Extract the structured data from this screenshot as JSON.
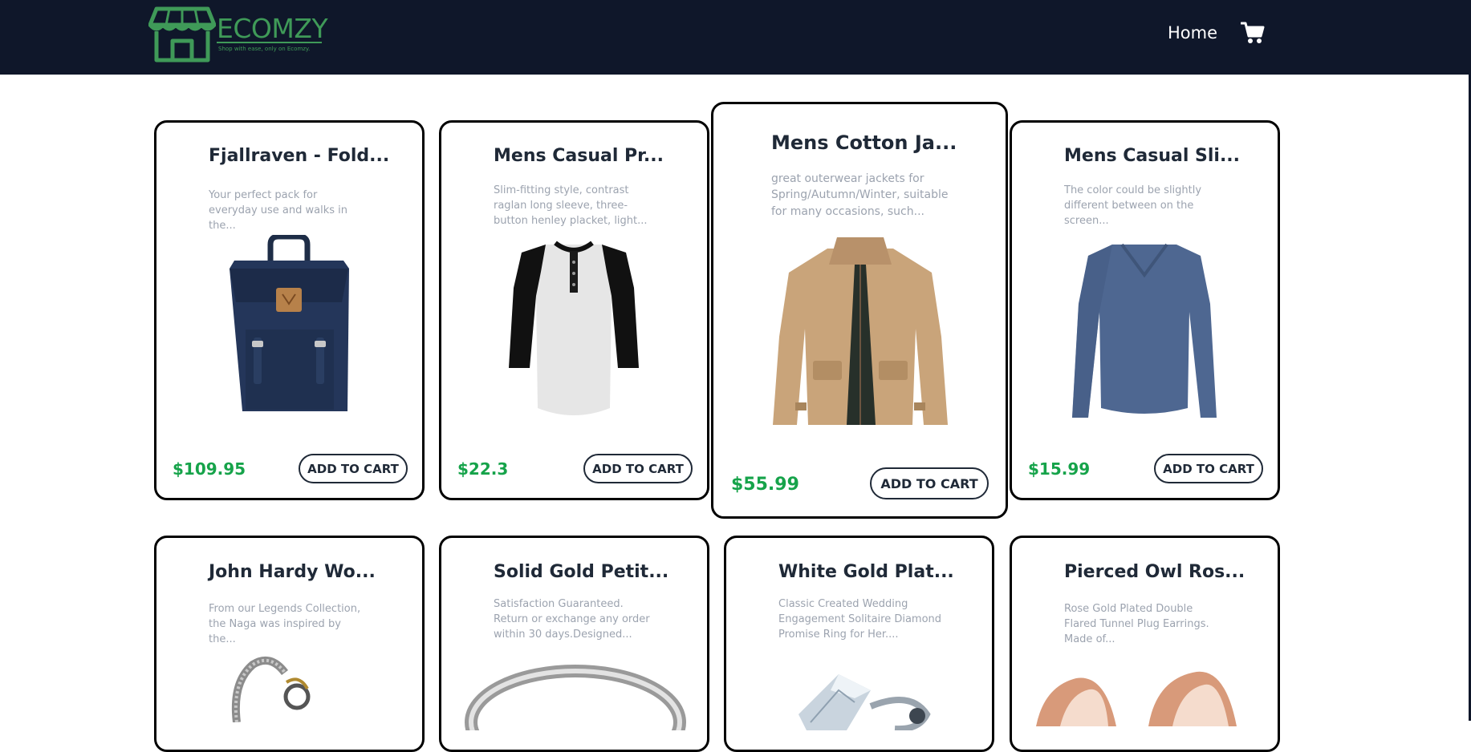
{
  "header": {
    "brand": "ECOMZY",
    "tagline": "Shop with ease, only on Ecomzy.",
    "nav_home": "Home",
    "cart_icon": "cart-icon",
    "background": "#0f172a",
    "brand_color": "#3f9a58"
  },
  "products": [
    {
      "title": "Fjallraven - Fold...",
      "description": "Your perfect pack for everyday use and walks in the...",
      "price": "$109.95",
      "button": "ADD TO CART",
      "image": "navy-backpack"
    },
    {
      "title": "Mens Casual Pr...",
      "description": "Slim-fitting style, contrast raglan long sleeve, three-button henley placket, light...",
      "price": "$22.3",
      "button": "ADD TO CART",
      "image": "raglan-henley-shirt"
    },
    {
      "title": "Mens Cotton Ja...",
      "description": "great outerwear jackets for Spring/Autumn/Winter, suitable for many occasions, such...",
      "price": "$55.99",
      "button": "ADD TO CART",
      "image": "tan-cotton-jacket"
    },
    {
      "title": "Mens Casual Sli...",
      "description": "The color could be slightly different between on the screen...",
      "price": "$15.99",
      "button": "ADD TO CART",
      "image": "blue-long-sleeve-shirt"
    },
    {
      "title": "John Hardy Wo...",
      "description": "From our Legends Collection, the Naga was inspired by the...",
      "image": "dragon-chain-bracelet"
    },
    {
      "title": "Solid Gold Petit...",
      "description": "Satisfaction Guaranteed. Return or exchange any order within 30 days.Designed...",
      "image": "silver-band-ring"
    },
    {
      "title": "White Gold Plat...",
      "description": "Classic Created Wedding Engagement Solitaire Diamond Promise Ring for Her....",
      "image": "diamond-ring"
    },
    {
      "title": "Pierced Owl Ros...",
      "description": "Rose Gold Plated Double Flared Tunnel Plug Earrings. Made of...",
      "image": "rose-gold-plugs"
    }
  ],
  "colors": {
    "price": "#16a34a",
    "title": "#1f2937",
    "description": "#9ca3af"
  }
}
